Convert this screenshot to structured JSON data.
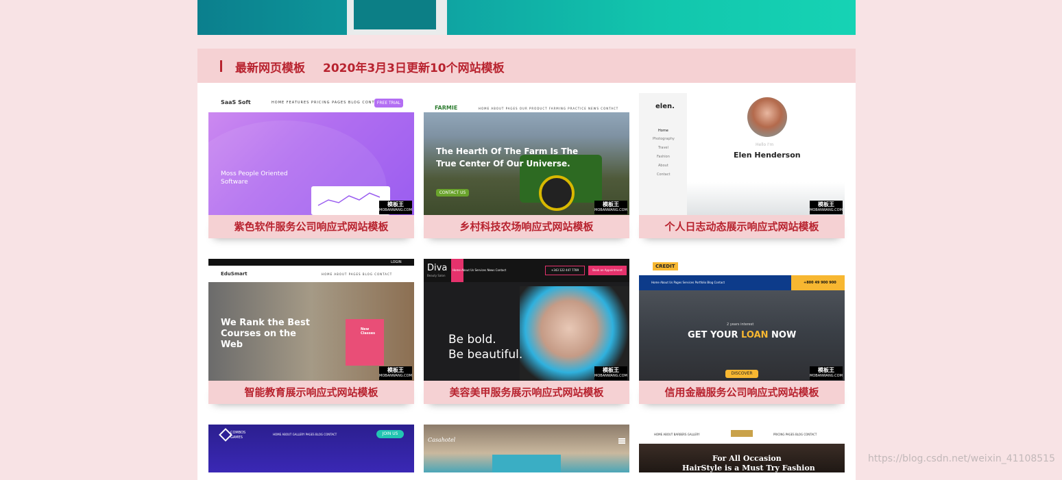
{
  "section": {
    "title": "最新网页模板",
    "subtitle": "2020年3月3日更新10个网站模板"
  },
  "watermark_badge": {
    "top": "模板王",
    "bottom": "MOBANWANG.COM"
  },
  "cards": [
    {
      "caption": "紫色软件服务公司响应式网站模板",
      "thumb": {
        "logo": "SaaS Soft",
        "nav": "HOME  FEATURES  PRICING  PAGES  BLOG  CONTACT",
        "cta": "FREE TRIAL",
        "headline": "Moss People Oriented Software"
      }
    },
    {
      "caption": "乡村科技农场响应式网站模板",
      "thumb": {
        "logo": "FARMIE",
        "nav": "HOME  ABOUT  PAGES  OUR PRODUCT  FARMING PRACTICE  NEWS  CONTACT",
        "headline": "The Hearth Of The Farm Is The True Center Of Our Universe.",
        "cta": "CONTACT US"
      }
    },
    {
      "caption": "个人日志动态展示响应式网站模板",
      "thumb": {
        "logo": "elen.",
        "menu": [
          "Home",
          "Photography",
          "Travel",
          "Fashion",
          "About",
          "Contact"
        ],
        "greeting": "Hello I'm",
        "name": "Elen Henderson"
      }
    },
    {
      "caption": "智能教育展示响应式网站模板",
      "thumb": {
        "logo": "EduSmart",
        "nav": "HOME  ABOUT  PAGES  BLOG  CONTACT",
        "login": "LOGIN",
        "headline": "We Rank the Best Courses on the Web",
        "box": "New Classes"
      }
    },
    {
      "caption": "美容美甲服务展示响应式网站模板",
      "thumb": {
        "logo": "Diva",
        "tagline": "Beauty Salon",
        "nav": "Home  About Us  Services  News  Contact",
        "phone": "+343 122 447 7789",
        "cta": "Book an Appointment",
        "headline1": "Be bold.",
        "headline2": "Be beautiful."
      }
    },
    {
      "caption": "信用金融服务公司响应式网站模板",
      "thumb": {
        "logo": "CREDIT",
        "nav": "Home  About Us  Pages  Services  Portfolio  Blog  Contact",
        "phone": "+800 49 900 900",
        "kicker": "2 years interest",
        "headline_a": "GET YOUR ",
        "headline_b": "LOAN",
        "headline_c": " NOW",
        "cta": "DISCOVER"
      }
    },
    {
      "caption": "",
      "thumb": {
        "logo": "COMBOS GAMES",
        "nav": "HOME  ABOUT  GALLERY  PAGES  BLOG  CONTACT",
        "cta": "JOIN US"
      }
    },
    {
      "caption": "",
      "thumb": {
        "logo": "Casahotel"
      }
    },
    {
      "caption": "",
      "thumb": {
        "nav": "HOME  ABOUT  BARBERS  GALLERY",
        "nav2": "PRICING  PAGES  BLOG  CONTACT",
        "headline1": "For All Occasion",
        "headline2": "HairStyle is a Must Try Fashion"
      }
    }
  ],
  "page_watermark": "https://blog.csdn.net/weixin_41108515",
  "colors": {
    "accent": "#b8232f",
    "page_bg": "#f8e3e5",
    "caption_bg": "#f5d1d3"
  }
}
